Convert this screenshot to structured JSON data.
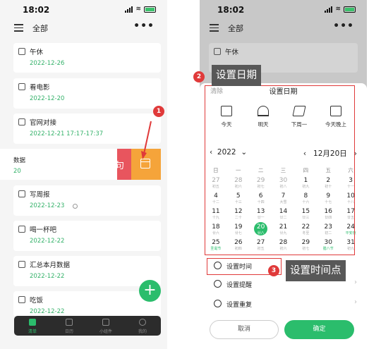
{
  "colors": {
    "accent": "#2bbd6c",
    "danger": "#e8555e",
    "orange": "#f5a43a",
    "highlight": "#e03a3a",
    "note_bg": "#585858"
  },
  "status": {
    "time": "18:02"
  },
  "header": {
    "title": "全部"
  },
  "tasks": [
    {
      "title": "午休",
      "date": "2022-12-26"
    },
    {
      "title": "看电影",
      "date": "2022-12-20"
    },
    {
      "title": "官网对接",
      "date": "2022-12-21 17:17-17:37"
    },
    {
      "title": "写周报",
      "date": "2022-12-23"
    },
    {
      "title": "喝一杯吧",
      "date": "2022-12-22"
    },
    {
      "title": "汇总本月数据",
      "date": "2022-12-22"
    },
    {
      "title": "吃饭",
      "date": "2022-12-22"
    }
  ],
  "swiped_task": {
    "title": "数据",
    "date": "20",
    "delete_partial": "句"
  },
  "tabs": [
    {
      "label": "清单",
      "icon": "checklist-icon"
    },
    {
      "label": "日历",
      "icon": "calendar-icon"
    },
    {
      "label": "小组件",
      "icon": "widget-icon"
    },
    {
      "label": "我的",
      "icon": "profile-icon"
    }
  ],
  "fab": "+",
  "annotations": {
    "b1": "1",
    "b2": "2",
    "b3": "3",
    "note_date": "设置日期",
    "note_time": "设置时间点"
  },
  "right_bg": {
    "header_title": "全部",
    "task_title": "午休"
  },
  "sheet": {
    "clear": "清除",
    "title": "设置日期",
    "quick": [
      {
        "label": "今天",
        "icon": "today-icon"
      },
      {
        "label": "明天",
        "icon": "sunrise-icon"
      },
      {
        "label": "下周一",
        "icon": "next-week-icon"
      },
      {
        "label": "今天晚上",
        "icon": "tonight-icon"
      }
    ],
    "year": "2022",
    "month": "12月20日",
    "weekdays": [
      "日",
      "一",
      "二",
      "三",
      "四",
      "五",
      "六"
    ],
    "weeks": [
      [
        {
          "n": "27",
          "l": "初五",
          "dim": true
        },
        {
          "n": "28",
          "l": "初六",
          "dim": true
        },
        {
          "n": "29",
          "l": "初七",
          "dim": true
        },
        {
          "n": "30",
          "l": "初八",
          "dim": true
        },
        {
          "n": "1",
          "l": "初九"
        },
        {
          "n": "2",
          "l": "初十"
        },
        {
          "n": "3",
          "l": "十一"
        }
      ],
      [
        {
          "n": "4",
          "l": "十二"
        },
        {
          "n": "5",
          "l": "十三"
        },
        {
          "n": "6",
          "l": "十四"
        },
        {
          "n": "7",
          "l": "大雪"
        },
        {
          "n": "8",
          "l": "十六"
        },
        {
          "n": "9",
          "l": "十七"
        },
        {
          "n": "10",
          "l": "十八"
        }
      ],
      [
        {
          "n": "11",
          "l": "十九"
        },
        {
          "n": "12",
          "l": "二十"
        },
        {
          "n": "13",
          "l": "廿一"
        },
        {
          "n": "14",
          "l": "廿二"
        },
        {
          "n": "15",
          "l": "廿三"
        },
        {
          "n": "16",
          "l": "廿四"
        },
        {
          "n": "17",
          "l": "廿五"
        }
      ],
      [
        {
          "n": "18",
          "l": "廿六"
        },
        {
          "n": "19",
          "l": "廿七"
        },
        {
          "n": "20",
          "l": "廿八",
          "today": true
        },
        {
          "n": "21",
          "l": "廿九"
        },
        {
          "n": "22",
          "l": "冬至"
        },
        {
          "n": "23",
          "l": "初二"
        },
        {
          "n": "24",
          "l": "平安夜",
          "green": true
        }
      ],
      [
        {
          "n": "25",
          "l": "圣诞节",
          "green": true
        },
        {
          "n": "26",
          "l": "初四"
        },
        {
          "n": "27",
          "l": "初五"
        },
        {
          "n": "28",
          "l": "初六"
        },
        {
          "n": "29",
          "l": "初七"
        },
        {
          "n": "30",
          "l": "腊八节",
          "green": true
        },
        {
          "n": "31",
          "l": "初九"
        }
      ]
    ],
    "options": [
      {
        "label": "设置时间",
        "icon": "clock-icon"
      },
      {
        "label": "设置提醒",
        "icon": "alarm-icon"
      },
      {
        "label": "设置重复",
        "icon": "repeat-icon"
      }
    ],
    "cancel": "取消",
    "confirm": "确定"
  }
}
